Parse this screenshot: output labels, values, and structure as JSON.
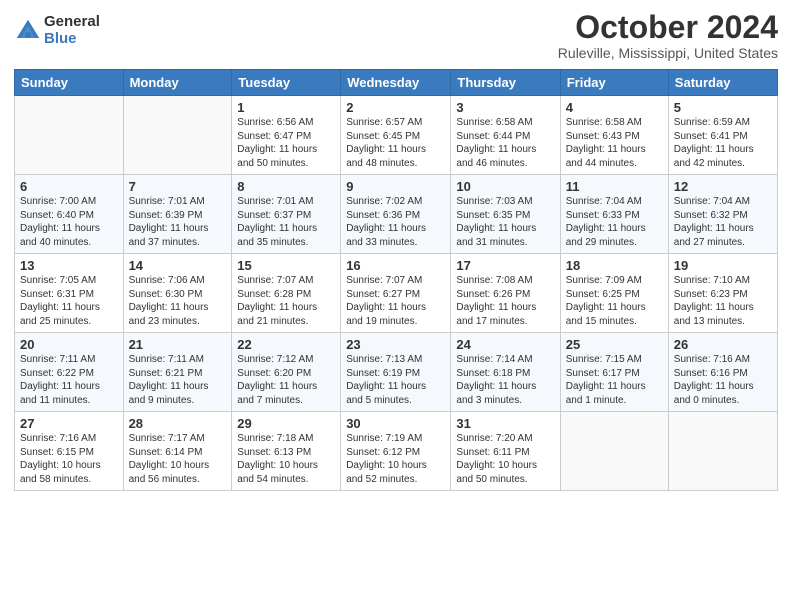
{
  "logo": {
    "general": "General",
    "blue": "Blue"
  },
  "title": "October 2024",
  "location": "Ruleville, Mississippi, United States",
  "days_of_week": [
    "Sunday",
    "Monday",
    "Tuesday",
    "Wednesday",
    "Thursday",
    "Friday",
    "Saturday"
  ],
  "weeks": [
    [
      {
        "day": "",
        "info": ""
      },
      {
        "day": "",
        "info": ""
      },
      {
        "day": "1",
        "info": "Sunrise: 6:56 AM\nSunset: 6:47 PM\nDaylight: 11 hours and 50 minutes."
      },
      {
        "day": "2",
        "info": "Sunrise: 6:57 AM\nSunset: 6:45 PM\nDaylight: 11 hours and 48 minutes."
      },
      {
        "day": "3",
        "info": "Sunrise: 6:58 AM\nSunset: 6:44 PM\nDaylight: 11 hours and 46 minutes."
      },
      {
        "day": "4",
        "info": "Sunrise: 6:58 AM\nSunset: 6:43 PM\nDaylight: 11 hours and 44 minutes."
      },
      {
        "day": "5",
        "info": "Sunrise: 6:59 AM\nSunset: 6:41 PM\nDaylight: 11 hours and 42 minutes."
      }
    ],
    [
      {
        "day": "6",
        "info": "Sunrise: 7:00 AM\nSunset: 6:40 PM\nDaylight: 11 hours and 40 minutes."
      },
      {
        "day": "7",
        "info": "Sunrise: 7:01 AM\nSunset: 6:39 PM\nDaylight: 11 hours and 37 minutes."
      },
      {
        "day": "8",
        "info": "Sunrise: 7:01 AM\nSunset: 6:37 PM\nDaylight: 11 hours and 35 minutes."
      },
      {
        "day": "9",
        "info": "Sunrise: 7:02 AM\nSunset: 6:36 PM\nDaylight: 11 hours and 33 minutes."
      },
      {
        "day": "10",
        "info": "Sunrise: 7:03 AM\nSunset: 6:35 PM\nDaylight: 11 hours and 31 minutes."
      },
      {
        "day": "11",
        "info": "Sunrise: 7:04 AM\nSunset: 6:33 PM\nDaylight: 11 hours and 29 minutes."
      },
      {
        "day": "12",
        "info": "Sunrise: 7:04 AM\nSunset: 6:32 PM\nDaylight: 11 hours and 27 minutes."
      }
    ],
    [
      {
        "day": "13",
        "info": "Sunrise: 7:05 AM\nSunset: 6:31 PM\nDaylight: 11 hours and 25 minutes."
      },
      {
        "day": "14",
        "info": "Sunrise: 7:06 AM\nSunset: 6:30 PM\nDaylight: 11 hours and 23 minutes."
      },
      {
        "day": "15",
        "info": "Sunrise: 7:07 AM\nSunset: 6:28 PM\nDaylight: 11 hours and 21 minutes."
      },
      {
        "day": "16",
        "info": "Sunrise: 7:07 AM\nSunset: 6:27 PM\nDaylight: 11 hours and 19 minutes."
      },
      {
        "day": "17",
        "info": "Sunrise: 7:08 AM\nSunset: 6:26 PM\nDaylight: 11 hours and 17 minutes."
      },
      {
        "day": "18",
        "info": "Sunrise: 7:09 AM\nSunset: 6:25 PM\nDaylight: 11 hours and 15 minutes."
      },
      {
        "day": "19",
        "info": "Sunrise: 7:10 AM\nSunset: 6:23 PM\nDaylight: 11 hours and 13 minutes."
      }
    ],
    [
      {
        "day": "20",
        "info": "Sunrise: 7:11 AM\nSunset: 6:22 PM\nDaylight: 11 hours and 11 minutes."
      },
      {
        "day": "21",
        "info": "Sunrise: 7:11 AM\nSunset: 6:21 PM\nDaylight: 11 hours and 9 minutes."
      },
      {
        "day": "22",
        "info": "Sunrise: 7:12 AM\nSunset: 6:20 PM\nDaylight: 11 hours and 7 minutes."
      },
      {
        "day": "23",
        "info": "Sunrise: 7:13 AM\nSunset: 6:19 PM\nDaylight: 11 hours and 5 minutes."
      },
      {
        "day": "24",
        "info": "Sunrise: 7:14 AM\nSunset: 6:18 PM\nDaylight: 11 hours and 3 minutes."
      },
      {
        "day": "25",
        "info": "Sunrise: 7:15 AM\nSunset: 6:17 PM\nDaylight: 11 hours and 1 minute."
      },
      {
        "day": "26",
        "info": "Sunrise: 7:16 AM\nSunset: 6:16 PM\nDaylight: 11 hours and 0 minutes."
      }
    ],
    [
      {
        "day": "27",
        "info": "Sunrise: 7:16 AM\nSunset: 6:15 PM\nDaylight: 10 hours and 58 minutes."
      },
      {
        "day": "28",
        "info": "Sunrise: 7:17 AM\nSunset: 6:14 PM\nDaylight: 10 hours and 56 minutes."
      },
      {
        "day": "29",
        "info": "Sunrise: 7:18 AM\nSunset: 6:13 PM\nDaylight: 10 hours and 54 minutes."
      },
      {
        "day": "30",
        "info": "Sunrise: 7:19 AM\nSunset: 6:12 PM\nDaylight: 10 hours and 52 minutes."
      },
      {
        "day": "31",
        "info": "Sunrise: 7:20 AM\nSunset: 6:11 PM\nDaylight: 10 hours and 50 minutes."
      },
      {
        "day": "",
        "info": ""
      },
      {
        "day": "",
        "info": ""
      }
    ]
  ]
}
